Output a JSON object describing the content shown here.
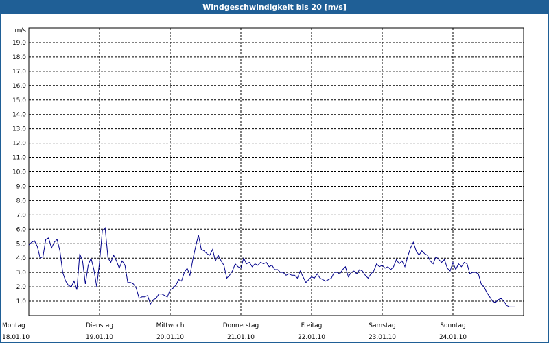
{
  "title": "Windgeschwindigkeit bis 20 [m/s]",
  "chart_data": {
    "type": "line",
    "title": "Windgeschwindigkeit bis 20 [m/s]",
    "ylabel": "m/s",
    "ylim": [
      0,
      20
    ],
    "y_ticks": [
      "1,0",
      "2,0",
      "3,0",
      "4,0",
      "5,0",
      "6,0",
      "7,0",
      "8,0",
      "9,0",
      "10,0",
      "11,0",
      "12,0",
      "13,0",
      "14,0",
      "15,0",
      "16,0",
      "17,0",
      "18,0",
      "19,0"
    ],
    "x_ticks": [
      {
        "day": "Montag",
        "date": "18.01.10"
      },
      {
        "day": "Dienstag",
        "date": "19.01.10"
      },
      {
        "day": "Mittwoch",
        "date": "20.01.10"
      },
      {
        "day": "Donnerstag",
        "date": "21.01.10"
      },
      {
        "day": "Freitag",
        "date": "22.01.10"
      },
      {
        "day": "Samstag",
        "date": "23.01.10"
      },
      {
        "day": "Sonntag",
        "date": "24.01.10"
      }
    ],
    "grid": true,
    "line_color": "#00008b",
    "series": [
      {
        "x": [
          0,
          0.04,
          0.08,
          0.12,
          0.16,
          0.2,
          0.24,
          0.28,
          0.32,
          0.36,
          0.4,
          0.44,
          0.48,
          0.52,
          0.56,
          0.6,
          0.64,
          0.68,
          0.72,
          0.76,
          0.8,
          0.84,
          0.88,
          0.92,
          0.96,
          1.0,
          1.04,
          1.08,
          1.12,
          1.16,
          1.2,
          1.24,
          1.28,
          1.32,
          1.36,
          1.4,
          1.44,
          1.48,
          1.52,
          1.56,
          1.6,
          1.64,
          1.68,
          1.72,
          1.76,
          1.8,
          1.84,
          1.88,
          1.92,
          1.96,
          2.0,
          2.04,
          2.08,
          2.12,
          2.16,
          2.2,
          2.24,
          2.28,
          2.32,
          2.36,
          2.4,
          2.44,
          2.48,
          2.52,
          2.56,
          2.6,
          2.64,
          2.68,
          2.72,
          2.76,
          2.8,
          2.84,
          2.88,
          2.92,
          2.96,
          3.0,
          3.04,
          3.08,
          3.12,
          3.16,
          3.2,
          3.24,
          3.28,
          3.32,
          3.36,
          3.4,
          3.44,
          3.48,
          3.52,
          3.56,
          3.6,
          3.64,
          3.68,
          3.72,
          3.76,
          3.8,
          3.84,
          3.88,
          3.92,
          3.96,
          4.0,
          4.04,
          4.08,
          4.12,
          4.16,
          4.2,
          4.24,
          4.28,
          4.32,
          4.36,
          4.4,
          4.44,
          4.48,
          4.52,
          4.56,
          4.6,
          4.64,
          4.68,
          4.72,
          4.76,
          4.8,
          4.84,
          4.88,
          4.92,
          4.96,
          5.0,
          5.04,
          5.08,
          5.12,
          5.16,
          5.2,
          5.24,
          5.28,
          5.32,
          5.36,
          5.4,
          5.44,
          5.48,
          5.52,
          5.56,
          5.6,
          5.64,
          5.68,
          5.72,
          5.76,
          5.8,
          5.84,
          5.88,
          5.92,
          5.96,
          6.0,
          6.04,
          6.08,
          6.12,
          6.16,
          6.2,
          6.24,
          6.28,
          6.32,
          6.36,
          6.4,
          6.44,
          6.48,
          6.52,
          6.56,
          6.6,
          6.64,
          6.68,
          6.72,
          6.76,
          6.8,
          6.84,
          6.88
        ],
        "values": [
          4.9,
          5.1,
          5.2,
          4.8,
          4.0,
          4.1,
          5.3,
          5.4,
          4.7,
          5.1,
          5.3,
          4.5,
          3.0,
          2.4,
          2.1,
          2.0,
          2.4,
          1.8,
          4.3,
          3.8,
          2.2,
          3.5,
          4.0,
          3.2,
          2.0,
          3.7,
          5.9,
          6.1,
          4.0,
          3.7,
          4.2,
          3.8,
          3.3,
          3.8,
          3.5,
          2.3,
          2.3,
          2.2,
          1.9,
          1.2,
          1.3,
          1.3,
          1.4,
          0.8,
          1.1,
          1.2,
          1.5,
          1.5,
          1.4,
          1.3,
          1.8,
          1.9,
          2.1,
          2.5,
          2.4,
          3.0,
          3.3,
          2.8,
          3.9,
          4.8,
          5.6,
          4.6,
          4.5,
          4.3,
          4.2,
          4.6,
          3.8,
          4.2,
          3.8,
          3.5,
          2.6,
          2.8,
          3.1,
          3.6,
          3.4,
          3.3,
          4.0,
          3.6,
          3.7,
          3.4,
          3.6,
          3.5,
          3.7,
          3.6,
          3.7,
          3.4,
          3.5,
          3.2,
          3.2,
          3.0,
          3.0,
          2.8,
          2.9,
          2.8,
          2.8,
          2.6,
          3.1,
          2.7,
          2.3,
          2.5,
          2.7,
          2.6,
          2.9,
          2.6,
          2.5,
          2.4,
          2.5,
          2.6,
          3.0,
          3.0,
          2.9,
          3.2,
          3.4,
          2.7,
          3.0,
          3.1,
          2.9,
          3.2,
          3.1,
          2.8,
          2.6,
          2.9,
          3.1,
          3.6,
          3.4,
          3.5,
          3.3,
          3.4,
          3.2,
          3.4,
          3.9,
          3.6,
          3.8,
          3.4,
          4.1,
          4.7,
          5.1,
          4.5,
          4.2,
          4.5,
          4.3,
          4.2,
          3.8,
          3.6,
          4.1,
          3.9,
          3.7,
          3.9,
          3.3,
          3.1,
          3.7,
          3.2,
          3.6,
          3.4,
          3.7,
          3.6,
          2.9,
          3.0,
          3.0,
          2.9,
          2.2,
          2.0,
          1.6,
          1.3,
          1.0,
          0.9,
          1.1,
          1.2,
          1.0,
          0.7,
          0.6,
          0.6,
          0.6
        ]
      }
    ]
  }
}
